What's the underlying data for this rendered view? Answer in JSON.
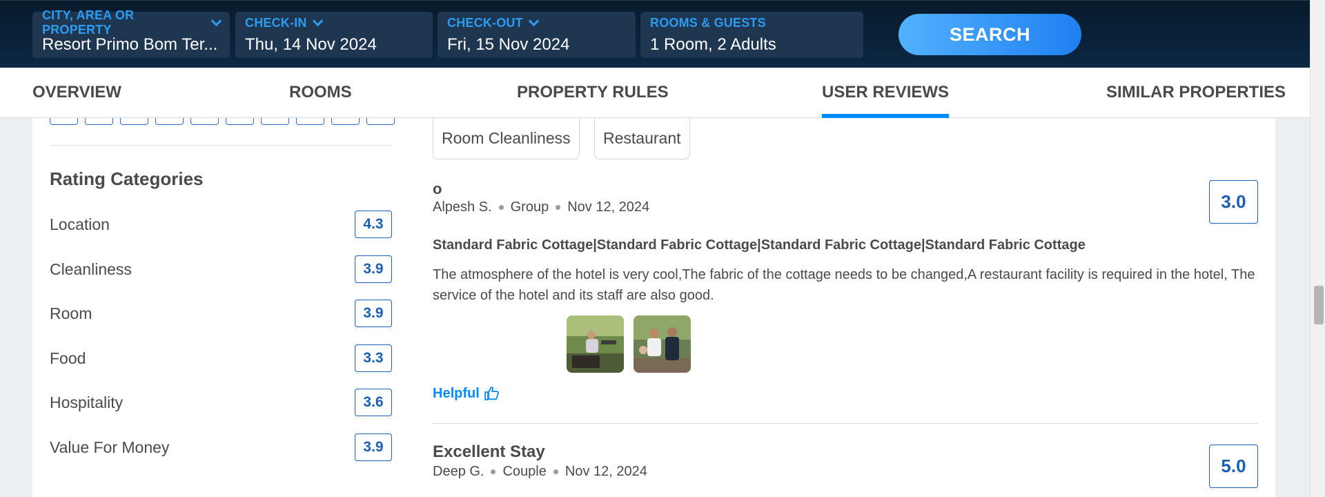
{
  "search": {
    "city_label": "CITY, AREA OR PROPERTY",
    "city_value": "Resort Primo Bom Ter...",
    "checkin_label": "CHECK-IN",
    "checkin_value": "Thu, 14 Nov 2024",
    "checkout_label": "CHECK-OUT",
    "checkout_value": "Fri, 15 Nov 2024",
    "rooms_label": "ROOMS & GUESTS",
    "rooms_value": "1 Room, 2 Adults",
    "button_label": "SEARCH"
  },
  "tabs": [
    {
      "label": "OVERVIEW"
    },
    {
      "label": "ROOMS"
    },
    {
      "label": "PROPERTY RULES"
    },
    {
      "label": "USER REVIEWS",
      "active": true
    },
    {
      "label": "SIMILAR PROPERTIES"
    }
  ],
  "rating_categories": {
    "title": "Rating Categories",
    "items": [
      {
        "name": "Location",
        "score": "4.3"
      },
      {
        "name": "Cleanliness",
        "score": "3.9"
      },
      {
        "name": "Room",
        "score": "3.9"
      },
      {
        "name": "Food",
        "score": "3.3"
      },
      {
        "name": "Hospitality",
        "score": "3.6"
      },
      {
        "name": "Value For Money",
        "score": "3.9"
      }
    ]
  },
  "filter_chips": [
    "Room Cleanliness",
    "Restaurant"
  ],
  "reviews": [
    {
      "title": "o",
      "author": "Alpesh S.",
      "traveller_type": "Group",
      "date": "Nov 12, 2024",
      "score": "3.0",
      "room": "Standard Fabric Cottage|Standard Fabric Cottage|Standard Fabric Cottage|Standard Fabric Cottage",
      "text": "The atmosphere of the hotel is very cool,The fabric of the cottage needs to be changed,A restaurant facility is required in the hotel, The service of the hotel and its staff are also good.",
      "helpful_label": "Helpful"
    },
    {
      "title": "Excellent Stay",
      "author": "Deep G.",
      "traveller_type": "Couple",
      "date": "Nov 12, 2024",
      "score": "5.0"
    }
  ],
  "colors": {
    "accent": "#008cff",
    "score_blue": "#1a5fb4",
    "header_bg": "#0c2843"
  }
}
